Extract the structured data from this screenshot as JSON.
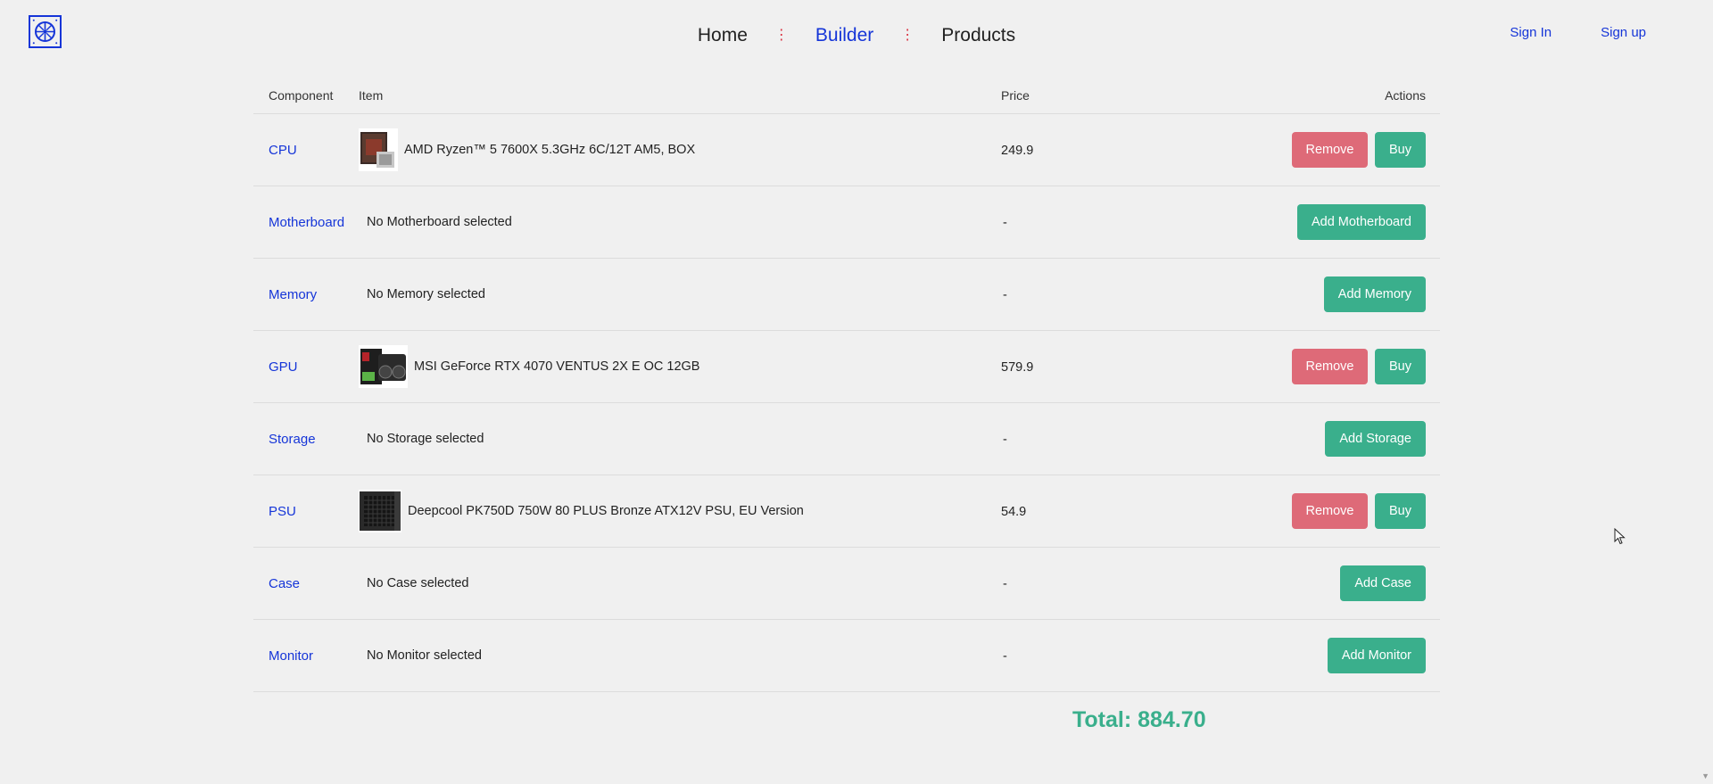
{
  "header": {
    "nav": [
      {
        "label": "Home",
        "active": false
      },
      {
        "label": "Builder",
        "active": true
      },
      {
        "label": "Products",
        "active": false
      }
    ],
    "nav_separator": "⋮",
    "sign_in": "Sign In",
    "sign_up": "Sign up"
  },
  "table": {
    "headers": {
      "component": "Component",
      "item": "Item",
      "price": "Price",
      "actions": "Actions"
    },
    "remove_label": "Remove",
    "buy_label": "Buy",
    "rows": [
      {
        "component": "CPU",
        "item": "AMD Ryzen™ 5 7600X 5.3GHz 6C/12T AM5, BOX",
        "price": "249.9",
        "selected": true
      },
      {
        "component": "Motherboard",
        "item": "No Motherboard selected",
        "price": "-",
        "selected": false,
        "add_label": "Add Motherboard"
      },
      {
        "component": "Memory",
        "item": "No Memory selected",
        "price": "-",
        "selected": false,
        "add_label": "Add Memory"
      },
      {
        "component": "GPU",
        "item": "MSI GeForce RTX 4070 VENTUS 2X E OC 12GB",
        "price": "579.9",
        "selected": true
      },
      {
        "component": "Storage",
        "item": "No Storage selected",
        "price": "-",
        "selected": false,
        "add_label": "Add Storage"
      },
      {
        "component": "PSU",
        "item": "Deepcool PK750D 750W 80 PLUS Bronze ATX12V PSU, EU Version",
        "price": "54.9",
        "selected": true
      },
      {
        "component": "Case",
        "item": "No Case selected",
        "price": "-",
        "selected": false,
        "add_label": "Add Case"
      },
      {
        "component": "Monitor",
        "item": "No Monitor selected",
        "price": "-",
        "selected": false,
        "add_label": "Add Monitor"
      }
    ]
  },
  "total": "Total: 884.70",
  "colors": {
    "accent": "#1535d8",
    "buy": "#3aaf8c",
    "remove": "#de6a78",
    "background": "#f0f0f0"
  }
}
